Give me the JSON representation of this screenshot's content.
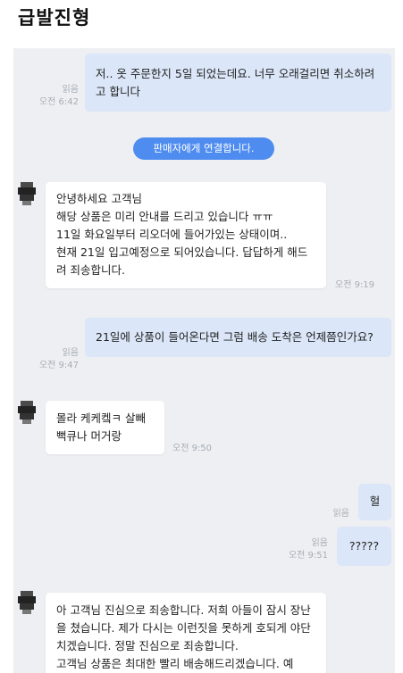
{
  "page": {
    "title": "급발진형"
  },
  "messages": {
    "m1": {
      "text": "저.. 옷 주문한지 5일 되었는데요. 너무 오래걸리면 취소하려고 합니다",
      "read": "읽음",
      "time": "오전 6:42"
    },
    "system_button": "판매자에게 연결합니다.",
    "m2": {
      "text": "안녕하세요 고객님\n해당 상품은 미리 안내를 드리고 있습니다 ㅠㅠ\n11일 화요일부터 리오더에 들어가있는 상태이며..\n현재 21일 입고예정으로 되어있습니다. 답답하게 해드려 죄송합니다.",
      "time": "오전 9:19"
    },
    "m3": {
      "text": "21일에 상품이 들어온다면 그럼 배송 도착은 언제쯤인가요?",
      "read": "읽음",
      "time": "오전 9:47"
    },
    "m4": {
      "text": "몰라 케케켘ㅋ 살빼\n뻑큐나 머거랑",
      "time": "오전 9:50"
    },
    "m5": {
      "text": "헐",
      "read": "읽음"
    },
    "m6": {
      "text": "?????",
      "read": "읽음",
      "time": "오전 9:51"
    },
    "m7": {
      "text": "아 고객님 진심으로 죄송합니다. 저희 아들이 잠시 장난을 쳤습니다. 제가 다시는 이런짓을 못하게 호되게 야단치겠습니다. 정말 진심으로 죄송합니다.\n고객님 상품은 최대한 빨리 배송해드리겠습니다. 예"
    }
  }
}
